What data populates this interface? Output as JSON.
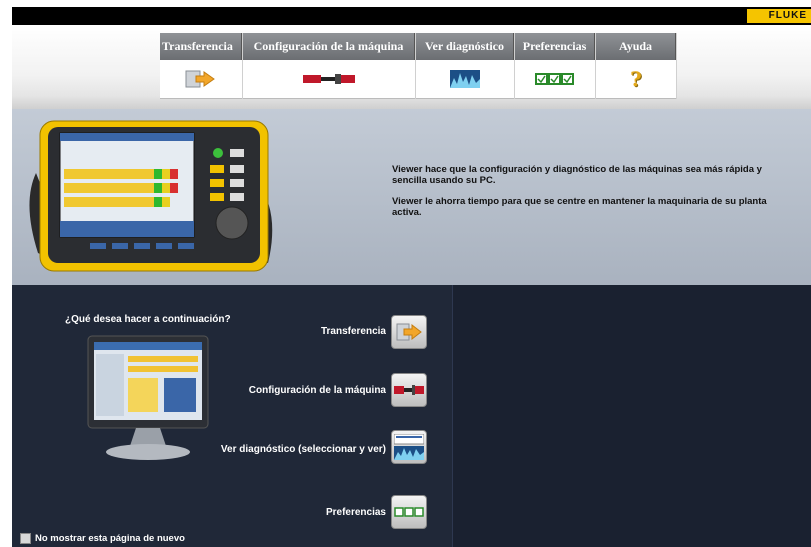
{
  "brand": "FLUKE",
  "tabs": [
    {
      "label": "Transferencia",
      "icon": "transfer-icon"
    },
    {
      "label": "Configuración de la máquina",
      "icon": "machine-config-icon"
    },
    {
      "label": "Ver diagnóstico",
      "icon": "diagnosis-icon"
    },
    {
      "label": "Preferencias",
      "icon": "preferences-icon"
    },
    {
      "label": "Ayuda",
      "icon": "help-icon"
    }
  ],
  "info": {
    "line1": "Viewer hace que la configuración y diagnóstico de las máquinas sea más rápida y sencilla usando su PC.",
    "line2": "Viewer le ahorra tiempo para que se centre en mantener la maquinaria de su planta activa."
  },
  "question": "¿Qué desea hacer a continuación?",
  "actions": [
    {
      "label": "Transferencia",
      "icon": "transfer-icon"
    },
    {
      "label": "Configuración de la máquina",
      "icon": "machine-config-icon"
    },
    {
      "label": "Ver diagnóstico (seleccionar y ver)",
      "icon": "diagnosis-icon"
    },
    {
      "label": "Preferencias",
      "icon": "preferences-icon"
    }
  ],
  "checkbox_label": "No mostrar esta página de nuevo",
  "colors": {
    "accent_yellow": "#f5c400",
    "dark_panel": "#1a2130",
    "tab_header": "#7c7f83"
  }
}
